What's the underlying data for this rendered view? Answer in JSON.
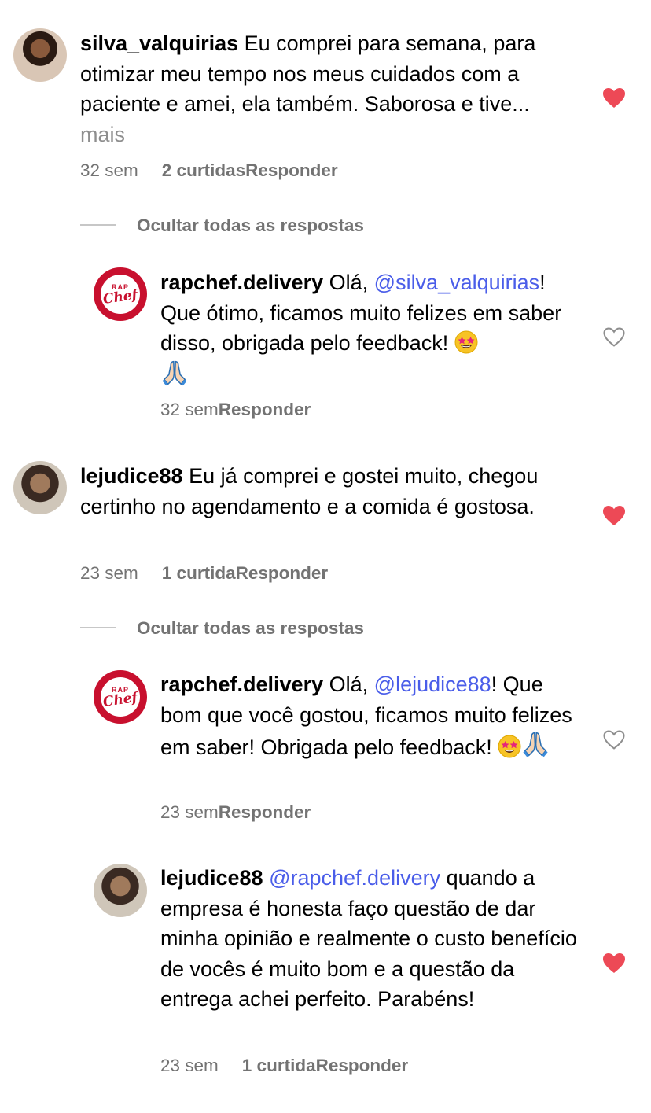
{
  "comments": [
    {
      "username": "silva_valquirias",
      "text": "Eu comprei para semana, para otimizar meu tempo nos meus cuidados com a paciente e amei, ela também. Saborosa e tive...",
      "more": "mais",
      "time": "32 sem",
      "likes": "2 curtidas",
      "reply": "Responder",
      "liked": true,
      "hide_replies": "Ocultar todas as respostas"
    },
    {
      "username": "rapchef.delivery",
      "text_before": "Olá, ",
      "mention": "@silva_valquirias",
      "text_after": "! Que ótimo, ficamos muito felizes em saber disso, obrigada pelo feedback!",
      "time": "32 sem",
      "reply": "Responder",
      "liked": false
    },
    {
      "username": "lejudice88",
      "text": "Eu já comprei e gostei muito, chegou certinho no agendamento e a comida é gostosa.",
      "time": "23 sem",
      "likes": "1 curtida",
      "reply": "Responder",
      "liked": true,
      "hide_replies": "Ocultar todas as respostas"
    },
    {
      "username": "rapchef.delivery",
      "text_before": "Olá, ",
      "mention": "@lejudice88",
      "text_after": "! Que bom que você gostou, ficamos muito felizes em saber! Obrigada pelo feedback!",
      "time": "23 sem",
      "reply": "Responder",
      "liked": false
    },
    {
      "username": "lejudice88",
      "mention": "@rapchef.delivery",
      "text_after": " quando a empresa é honesta faço questão de dar minha opinião e realmente o custo benefício de vocês é muito bom e a questão da entrega achei perfeito. Parabéns!",
      "time": "23 sem",
      "likes": "1 curtida",
      "reply": "Responder",
      "liked": true
    }
  ],
  "logo": {
    "line1": "RAP",
    "line2": "Chef"
  },
  "colors": {
    "heart_liked": "#ed4956",
    "mention": "#4a5de9",
    "meta": "#737373",
    "logo_red": "#c8102e"
  },
  "icons": [
    "heart-filled-icon",
    "heart-outline-icon",
    "star-struck-emoji-icon",
    "folded-hands-emoji-icon"
  ]
}
